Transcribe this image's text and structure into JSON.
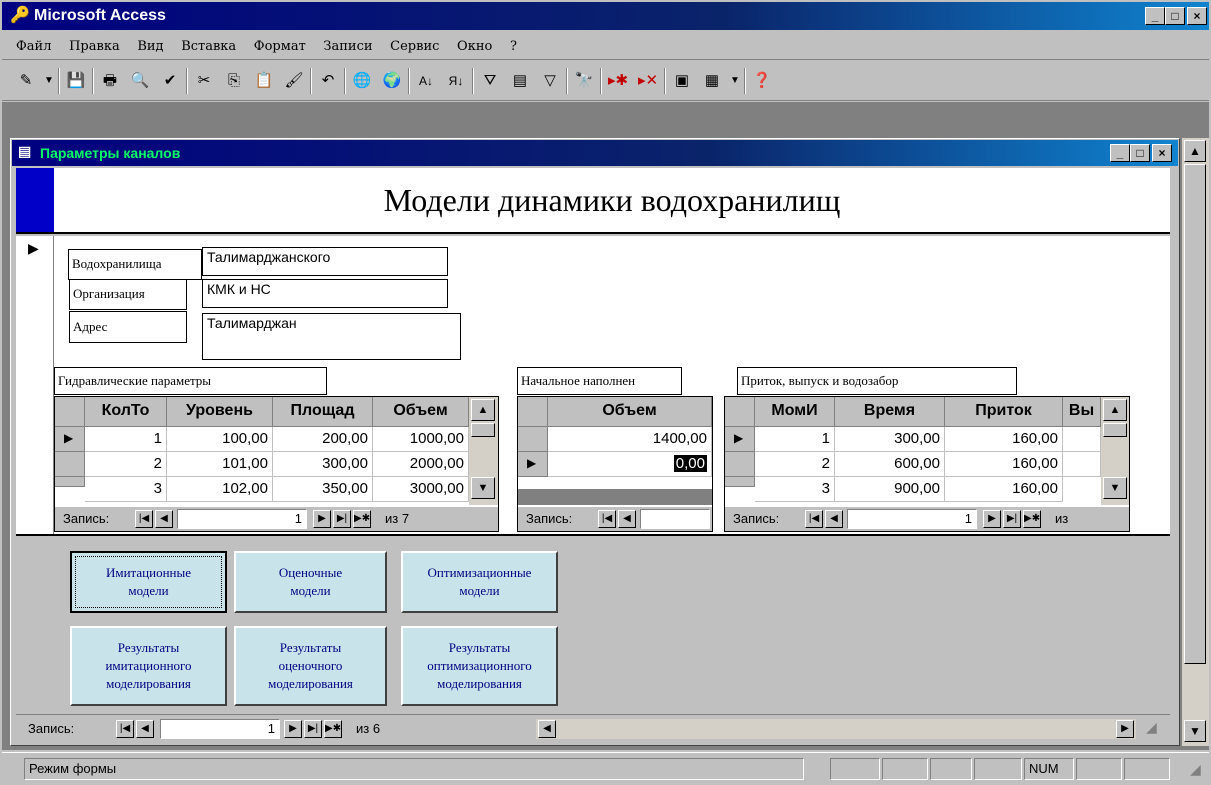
{
  "app": {
    "title": "Microsoft Access"
  },
  "menu": [
    "Файл",
    "Правка",
    "Вид",
    "Вставка",
    "Формат",
    "Записи",
    "Сервис",
    "Окно",
    "?"
  ],
  "form": {
    "title": "Параметры каналов",
    "heading": "Модели динамики водохранилищ",
    "fields": [
      {
        "label": "Водохранилища",
        "value": "Талимарджанского"
      },
      {
        "label": "Организация",
        "value": "КМК и НС"
      },
      {
        "label": "Адрес",
        "value": "Талимарджан"
      }
    ]
  },
  "hydro": {
    "caption": "Гидравлические параметры",
    "columns": [
      "КолТо",
      "Уровень",
      "Площад",
      "Объем"
    ],
    "rows": [
      [
        "1",
        "100,00",
        "200,00",
        "1000,00"
      ],
      [
        "2",
        "101,00",
        "300,00",
        "2000,00"
      ],
      [
        "3",
        "102,00",
        "350,00",
        "3000,00"
      ]
    ],
    "nav": {
      "label": "Запись:",
      "current": "1",
      "total": "из 7"
    }
  },
  "initial": {
    "caption": "Начальное наполнен",
    "columns": [
      "Объем"
    ],
    "rows": [
      [
        "1400,00"
      ],
      [
        "0,00"
      ]
    ],
    "nav": {
      "label": "Запись:",
      "current": ""
    }
  },
  "inflow": {
    "caption": "Приток, выпуск и водозабор",
    "columns": [
      "МомИ",
      "Время",
      "Приток",
      "Вы"
    ],
    "rows": [
      [
        "1",
        "300,00",
        "160,00",
        ""
      ],
      [
        "2",
        "600,00",
        "160,00",
        ""
      ],
      [
        "3",
        "900,00",
        "160,00",
        ""
      ]
    ],
    "nav": {
      "label": "Запись:",
      "current": "1",
      "total": "из"
    }
  },
  "buttons": {
    "imitation": "Имитационные\nмодели",
    "evaluation": "Оценочные\nмодели",
    "optimization": "Оптимизационные\nмодели",
    "res_imitation": "Результаты\nимитационного\nмоделирования",
    "res_evaluation": "Результаты\nоценочного\nмоделирования",
    "res_optimization": "Результаты\nоптимизационного\nмоделирования"
  },
  "form_nav": {
    "label": "Запись:",
    "current": "1",
    "total": "из 6"
  },
  "status": {
    "mode": "Режим формы",
    "num": "NUM"
  },
  "colors": {
    "title_bar": "#000080",
    "window_bg": "#c0c0c0",
    "button_bg": "#c8e4ea",
    "button_text": "#000080"
  }
}
